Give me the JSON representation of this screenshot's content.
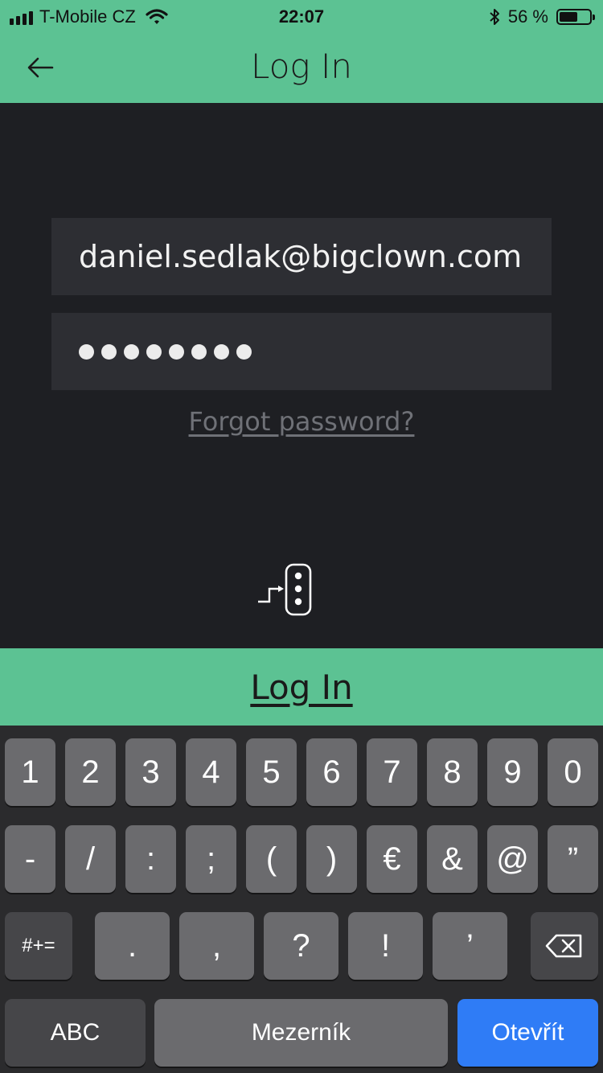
{
  "status_bar": {
    "carrier": "T-Mobile CZ",
    "time": "22:07",
    "battery": "56 %",
    "battery_level": 0.56
  },
  "header": {
    "title": "Log In",
    "back_icon": "arrow-left-icon"
  },
  "form": {
    "email_value": "daniel.sedlak@bigclown.com",
    "password_length": 8,
    "forgot_label": "Forgot password?"
  },
  "login_button": {
    "label": "Log In"
  },
  "keyboard": {
    "row1": [
      "1",
      "2",
      "3",
      "4",
      "5",
      "6",
      "7",
      "8",
      "9",
      "0"
    ],
    "row2": [
      "-",
      "/",
      ":",
      ";",
      "(",
      ")",
      "€",
      "&",
      "@",
      "”"
    ],
    "row3_mode": "#+=",
    "row3": [
      ".",
      ",",
      "?",
      "!",
      "’"
    ],
    "abc_label": "ABC",
    "space_label": "Mezerník",
    "return_label": "Otevřít"
  },
  "colors": {
    "accent": "#5cc293",
    "background": "#1e1f23",
    "field": "#2d2e33",
    "return_key": "#2f7cf6"
  }
}
